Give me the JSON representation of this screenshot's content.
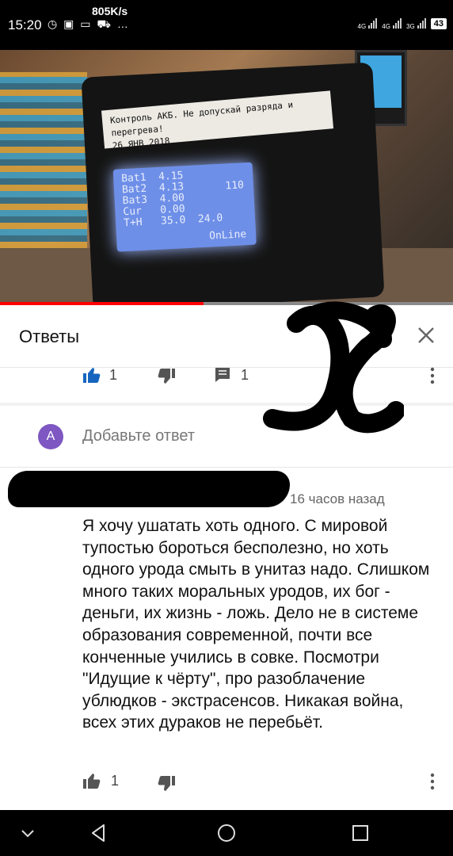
{
  "status_bar": {
    "time": "15:20",
    "icons": [
      "alarm-icon",
      "gallery-icon",
      "image-icon",
      "bus-icon",
      "more-dots"
    ],
    "network_speed": "805K/s",
    "sim1_label": "4G",
    "sim2_label": "4G",
    "sim3_label": "3G",
    "battery": "43"
  },
  "video": {
    "device_label_line1": "Контроль АКБ. Не допускай разряда и перегрева!",
    "device_label_line2": "26 ЯНВ 2018",
    "lcd_rows": [
      "Bat1  4.15",
      "Bat2  4.13",
      "Bat3  4.00",
      "Cur   0.00",
      "T+H   35.0  24.0"
    ],
    "lcd_side_value": "110",
    "lcd_status": "OnLine",
    "progress_fraction": 0.45,
    "progress_color": "#ff0000"
  },
  "replies": {
    "title": "Ответы",
    "close_icon": "close-icon"
  },
  "parent_actions": {
    "like_count": "1",
    "reply_count": "1"
  },
  "add_reply": {
    "avatar_letter": "A",
    "placeholder": "Добавьте ответ",
    "avatar_color": "#7e57c2"
  },
  "comment": {
    "time_ago": "16 часов назад",
    "text": "Я хочу ушатать хоть одного. С мировой тупостью бороться бесполезно, но хоть одного урода смыть в унитаз надо. Слишком много таких моральных уродов, их бог - деньги, их жизнь - ложь. Дело не в системе образования современной, почти все конченные учились в совке. Посмотри \"Идущие к чёрту\", про разоблачение ублюдков - экстрасенсов. Никакая война, всех этих дураков не перебьёт.",
    "like_count": "1"
  },
  "nav_bar": {
    "buttons": [
      "chevron-down-icon",
      "back-icon",
      "home-icon",
      "recents-icon"
    ]
  }
}
